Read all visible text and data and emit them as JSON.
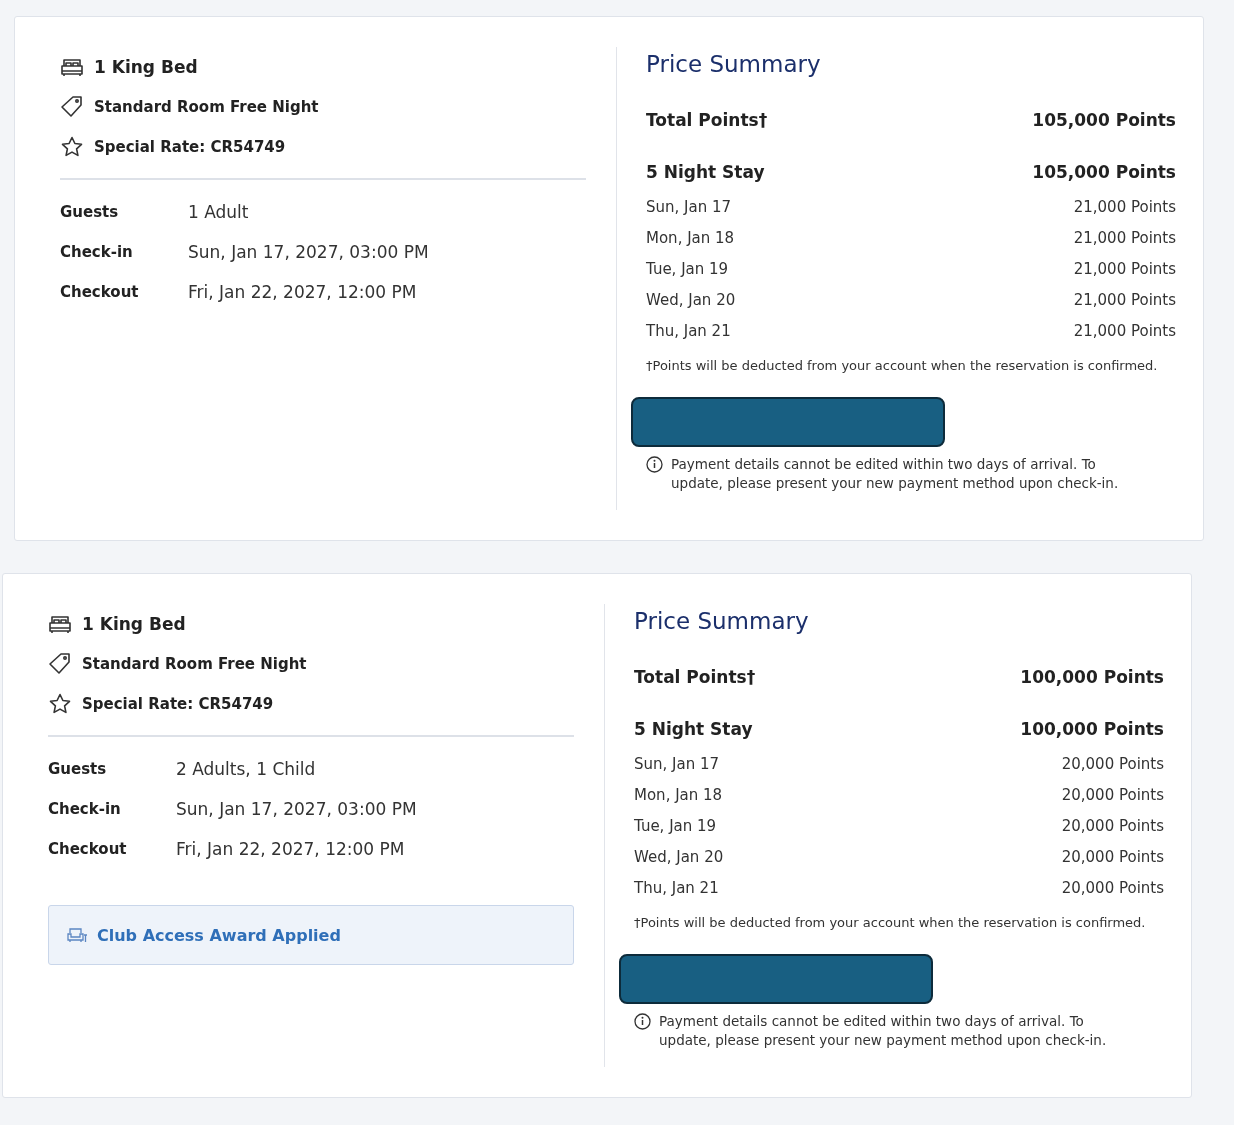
{
  "reservations": [
    {
      "room": {
        "bed": "1 King Bed",
        "rate": "Standard Room Free Night",
        "special": "Special Rate: CR54749"
      },
      "details": [
        {
          "label": "Guests",
          "value": "1 Adult"
        },
        {
          "label": "Check-in",
          "value": "Sun, Jan 17, 2027, 03:00 PM"
        },
        {
          "label": "Checkout",
          "value": "Fri, Jan 22, 2027, 12:00 PM"
        }
      ],
      "price_summary": {
        "title": "Price Summary",
        "total_label": "Total Points†",
        "total_value": "105,000 Points",
        "stay_label": "5 Night Stay",
        "stay_value": "105,000 Points",
        "nights": [
          {
            "date": "Sun, Jan 17",
            "points": "21,000 Points"
          },
          {
            "date": "Mon, Jan 18",
            "points": "21,000 Points"
          },
          {
            "date": "Tue, Jan 19",
            "points": "21,000 Points"
          },
          {
            "date": "Wed, Jan 20",
            "points": "21,000 Points"
          },
          {
            "date": "Thu, Jan 21",
            "points": "21,000 Points"
          }
        ],
        "footnote": "†Points will be deducted from your account when the reservation is confirmed.",
        "note": "Payment details cannot be edited within two days of arrival. To update, please present your new payment method upon check-in."
      }
    },
    {
      "room": {
        "bed": "1 King Bed",
        "rate": "Standard Room Free Night",
        "special": "Special Rate: CR54749"
      },
      "details": [
        {
          "label": "Guests",
          "value": "2 Adults, 1 Child"
        },
        {
          "label": "Check-in",
          "value": "Sun, Jan 17, 2027, 03:00 PM"
        },
        {
          "label": "Checkout",
          "value": "Fri, Jan 22, 2027, 12:00 PM"
        }
      ],
      "award": "Club Access Award Applied",
      "price_summary": {
        "title": "Price Summary",
        "total_label": "Total Points†",
        "total_value": "100,000 Points",
        "stay_label": "5 Night Stay",
        "stay_value": "100,000 Points",
        "nights": [
          {
            "date": "Sun, Jan 17",
            "points": "20,000 Points"
          },
          {
            "date": "Mon, Jan 18",
            "points": "20,000 Points"
          },
          {
            "date": "Tue, Jan 19",
            "points": "20,000 Points"
          },
          {
            "date": "Wed, Jan 20",
            "points": "20,000 Points"
          },
          {
            "date": "Thu, Jan 21",
            "points": "20,000 Points"
          }
        ],
        "footnote": "†Points will be deducted from your account when the reservation is confirmed.",
        "note": "Payment details cannot be edited within two days of arrival. To update, please present your new payment method upon check-in."
      }
    }
  ]
}
